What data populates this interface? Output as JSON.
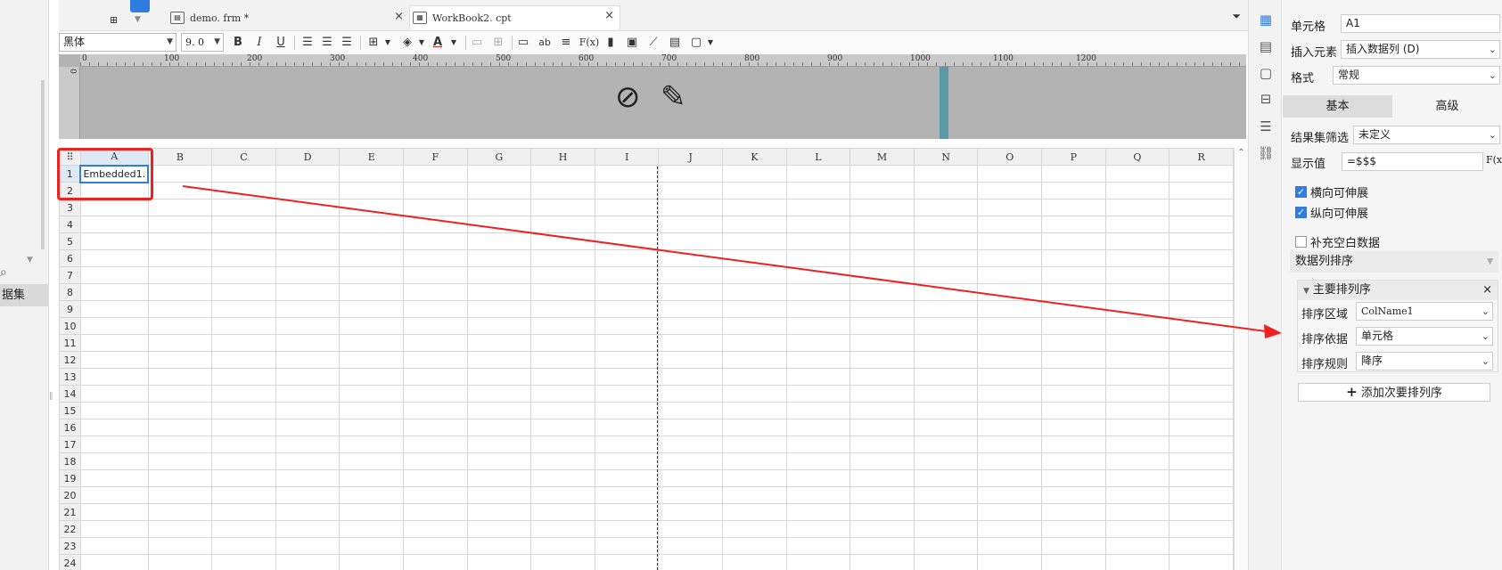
{
  "left_pane": {
    "item_label": "据集"
  },
  "tabs": [
    {
      "label": "demo. frm *",
      "close": "×"
    },
    {
      "label": "WorkBook2. cpt",
      "close": "×"
    }
  ],
  "toolbar": {
    "font_name": "黑体",
    "font_size": "9. 0",
    "bold": "B",
    "italic": "I",
    "underline": "U",
    "text_btn": "ab",
    "formula_btn": "F(x)"
  },
  "ruler": {
    "marks": [
      "0",
      "100",
      "200",
      "300",
      "400",
      "500",
      "600",
      "700",
      "800",
      "900",
      "1000",
      "1100",
      "1200"
    ]
  },
  "sheet": {
    "columns": [
      "A",
      "B",
      "C",
      "D",
      "E",
      "F",
      "G",
      "H",
      "I",
      "J",
      "K",
      "L",
      "M",
      "N",
      "O",
      "P",
      "Q",
      "R"
    ],
    "rows": [
      "1",
      "2",
      "3",
      "4",
      "5",
      "6",
      "7",
      "8",
      "9",
      "10",
      "11",
      "12",
      "13",
      "14",
      "15",
      "16",
      "17",
      "18",
      "19",
      "20",
      "21",
      "22",
      "23",
      "24"
    ],
    "cell_A1": "Embedded1."
  },
  "panel": {
    "cell_label": "单元格",
    "cell_value": "A1",
    "insert_label": "插入元素",
    "insert_value": "插入数据列 (D)",
    "format_label": "格式",
    "format_value": "常规",
    "tab_basic": "基本",
    "tab_advanced": "高级",
    "filter_label": "结果集筛选",
    "filter_value": "未定义",
    "display_label": "显示值",
    "display_value": "=$$$",
    "display_fx": "F(x)",
    "check_h": "横向可伸展",
    "check_v": "纵向可伸展",
    "check_fill": "补充空白数据",
    "sort_section": "数据列排序",
    "primary_sort": "主要排列序",
    "sort_area_label": "排序区域",
    "sort_area_value": "ColName1",
    "sort_basis_label": "排序依据",
    "sort_basis_value": "单元格",
    "sort_rule_label": "排序规则",
    "sort_rule_value": "降序",
    "add_secondary": "添加次要排列序"
  },
  "colors": {
    "accent": "#2f7de1",
    "annotation_red": "#f02020"
  }
}
